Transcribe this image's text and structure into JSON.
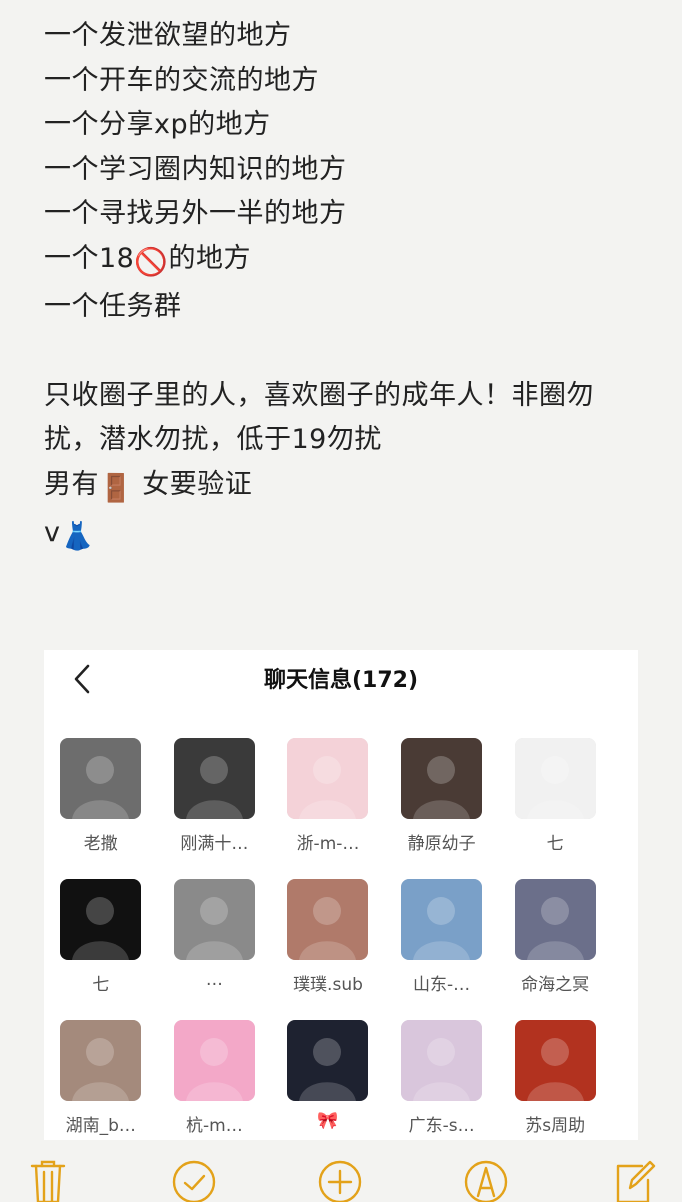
{
  "note": {
    "lines": [
      "一个发泄欲望的地方",
      "一个开车的交流的地方",
      "一个分享xp的地方",
      "一个学习圈内知识的地方",
      "一个寻找另外一半的地方",
      "一个18",
      "一个任务群"
    ],
    "line6_emoji": "🚫",
    "line6_suffix": "的地方",
    "paragraph": "只收圈子里的人，喜欢圈子的成年人！非圈勿扰，潜水勿扰，低于19勿扰",
    "male_prefix": "男有",
    "male_emoji": "🚪",
    "male_suffix": " 女要验证",
    "v_prefix": "v",
    "v_emoji": "👗"
  },
  "chat_info": {
    "title": "聊天信息(172)",
    "back_icon": "chevron-left-icon",
    "members": [
      {
        "name": "老撒",
        "color": "#6d6d6d"
      },
      {
        "name": "刚满十…",
        "color": "#3a3a3a"
      },
      {
        "name": "浙-m-…",
        "color": "#f4d2d8"
      },
      {
        "name": "静原幼子",
        "color": "#4a3b35"
      },
      {
        "name": "七",
        "color": "#f1f1f1"
      },
      {
        "name": "七",
        "color": "#111111"
      },
      {
        "name": "…",
        "color": "#8a8a8a"
      },
      {
        "name": "璞璞.sub",
        "color": "#b07a6a"
      },
      {
        "name": "山东-…",
        "color": "#7aa0c8"
      },
      {
        "name": "命海之冥",
        "color": "#6b6f8a"
      },
      {
        "name": "湖南_b…",
        "color": "#a48a7c"
      },
      {
        "name": "杭-m…",
        "color": "#f3a8c8"
      },
      {
        "name": "🎀",
        "color": "#1e2230"
      },
      {
        "name": "广东-s…",
        "color": "#d9c6dc"
      },
      {
        "name": "苏s周助",
        "color": "#b2321f"
      }
    ]
  },
  "toolbar": {
    "icons": [
      "trash-icon",
      "checkmark-circle-icon",
      "plus-circle-icon",
      "markup-pen-icon",
      "compose-icon"
    ],
    "accent": "#e3a21a"
  }
}
